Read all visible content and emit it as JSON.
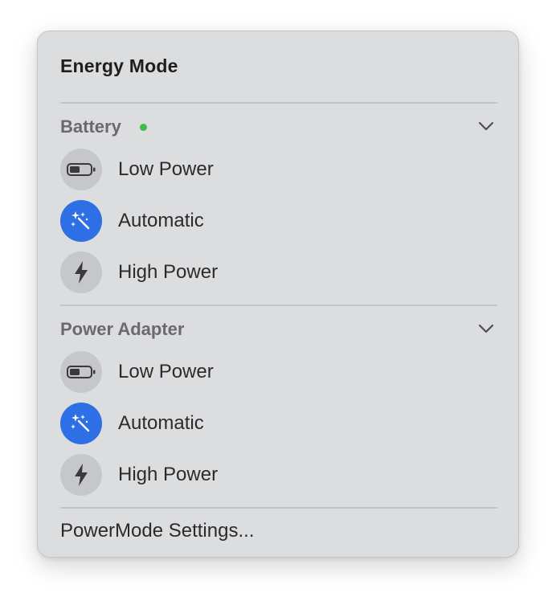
{
  "menu": {
    "title": "Energy Mode",
    "sections": [
      {
        "label": "Battery",
        "status_active": true,
        "status_color": "#3ebd4c",
        "expand_icon": "chevron-down-icon",
        "items": [
          {
            "label": "Low Power",
            "icon": "battery-icon",
            "selected": false
          },
          {
            "label": "Automatic",
            "icon": "magic-wand-icon",
            "selected": true
          },
          {
            "label": "High Power",
            "icon": "bolt-icon",
            "selected": false
          }
        ]
      },
      {
        "label": "Power Adapter",
        "status_active": false,
        "expand_icon": "chevron-down-icon",
        "items": [
          {
            "label": "Low Power",
            "icon": "battery-icon",
            "selected": false
          },
          {
            "label": "Automatic",
            "icon": "magic-wand-icon",
            "selected": true
          },
          {
            "label": "High Power",
            "icon": "bolt-icon",
            "selected": false
          }
        ]
      }
    ],
    "footer_link": "PowerMode Settings...",
    "colors": {
      "accent": "#2f6fe6",
      "background": "#dcdddf"
    }
  }
}
